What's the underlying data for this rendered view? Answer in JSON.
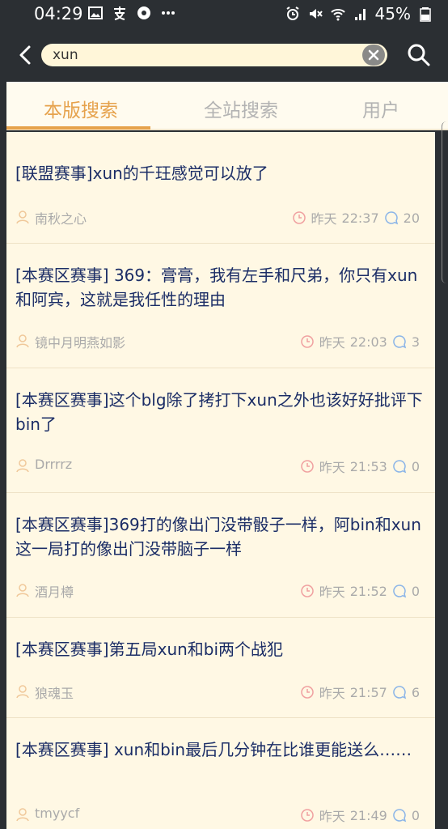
{
  "status_bar": {
    "time": "04:29",
    "battery": "45%"
  },
  "search": {
    "value": "xun"
  },
  "tabs": [
    {
      "label": "本版搜索",
      "active": true
    },
    {
      "label": "全站搜索",
      "active": false
    },
    {
      "label": "用户",
      "active": false
    }
  ],
  "results": [
    {
      "title": "[联盟赛事]xun的千玨感觉可以放了",
      "author": "南秋之心",
      "day": "昨天",
      "time": "22:37",
      "replies": "20"
    },
    {
      "title": "[本赛区赛事] 369：膏膏，我有左手和尺弟，你只有xun和阿宾，这就是我任性的理由",
      "author": "镜中月明燕如影",
      "day": "昨天",
      "time": "22:03",
      "replies": "3"
    },
    {
      "title": "[本赛区赛事]这个blg除了拷打下xun之外也该好好批评下bin了",
      "author": "Drrrrz",
      "day": "昨天",
      "time": "21:53",
      "replies": "0"
    },
    {
      "title": "[本赛区赛事]369打的像出门没带骰子一样，阿bin和xun这一局打的像出门没带脑子一样",
      "author": "酒月樽",
      "day": "昨天",
      "time": "21:52",
      "replies": "0"
    },
    {
      "title": "[本赛区赛事]第五局xun和bi两个战犯",
      "author": "狼魂玉",
      "day": "昨天",
      "time": "21:57",
      "replies": "6"
    },
    {
      "title": "[本赛区赛事] xun和bin最后几分钟在比谁更能送么……",
      "author": "tmyycf",
      "day": "昨天",
      "time": "21:49",
      "replies": "0"
    }
  ],
  "colors": {
    "accent": "#e6a24c",
    "title_text": "#1b2d66",
    "header_bg": "#2b2f33",
    "list_bg": "#fff8e4"
  }
}
